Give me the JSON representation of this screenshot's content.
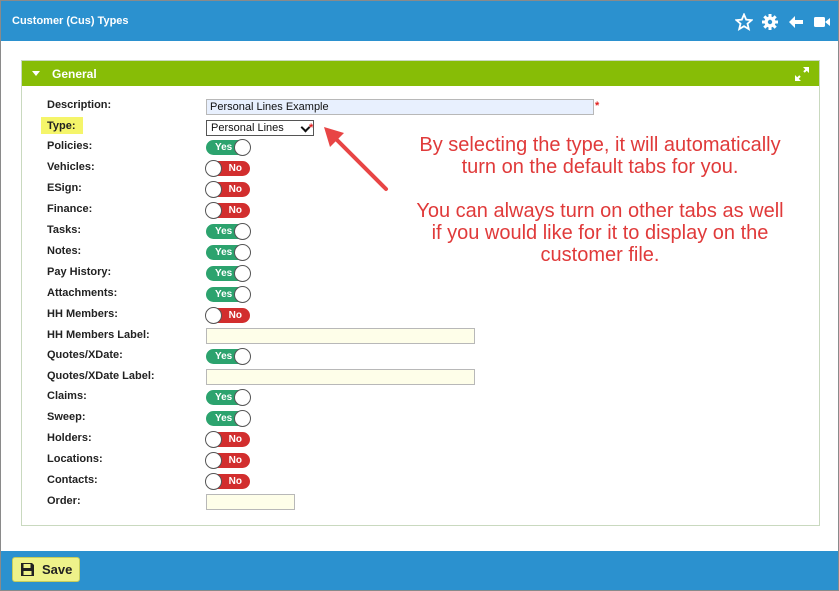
{
  "window": {
    "title": "Customer (Cus) Types",
    "icons": [
      "star-icon",
      "gear-icon",
      "back-arrow-icon",
      "video-icon"
    ]
  },
  "panel": {
    "title": "General"
  },
  "fields": {
    "description": {
      "label": "Description:",
      "value": "Personal Lines Example"
    },
    "type": {
      "label": "Type:",
      "value": "Personal Lines"
    },
    "policies": {
      "label": "Policies:",
      "value": "Yes"
    },
    "vehicles": {
      "label": "Vehicles:",
      "value": "No"
    },
    "esign": {
      "label": "ESign:",
      "value": "No"
    },
    "finance": {
      "label": "Finance:",
      "value": "No"
    },
    "tasks": {
      "label": "Tasks:",
      "value": "Yes"
    },
    "notes": {
      "label": "Notes:",
      "value": "Yes"
    },
    "pay_history": {
      "label": "Pay History:",
      "value": "Yes"
    },
    "attachments": {
      "label": "Attachments:",
      "value": "Yes"
    },
    "hh_members": {
      "label": "HH Members:",
      "value": "No"
    },
    "hh_members_label": {
      "label": "HH Members Label:",
      "value": ""
    },
    "quotes_xdate": {
      "label": "Quotes/XDate:",
      "value": "Yes"
    },
    "quotes_xdate_label": {
      "label": "Quotes/XDate Label:",
      "value": ""
    },
    "claims": {
      "label": "Claims:",
      "value": "Yes"
    },
    "sweep": {
      "label": "Sweep:",
      "value": "Yes"
    },
    "holders": {
      "label": "Holders:",
      "value": "No"
    },
    "locations": {
      "label": "Locations:",
      "value": "No"
    },
    "contacts": {
      "label": "Contacts:",
      "value": "No"
    },
    "order": {
      "label": "Order:",
      "value": ""
    }
  },
  "required_marker": "*",
  "annotation": {
    "line1": "By selecting the type, it will automatically",
    "line2": "turn on the default tabs for you.",
    "line3": "You can always turn on other tabs as well",
    "line4": "if you would like for it to display on the",
    "line5": "customer file."
  },
  "colors": {
    "header": "#2b91cf",
    "panel_header": "#87bd06",
    "toggle_yes": "#2ca36e",
    "toggle_no": "#d22e2e",
    "annotation": "#e03a3a",
    "highlight": "#f5f56a"
  },
  "footer": {
    "save_label": "Save"
  }
}
